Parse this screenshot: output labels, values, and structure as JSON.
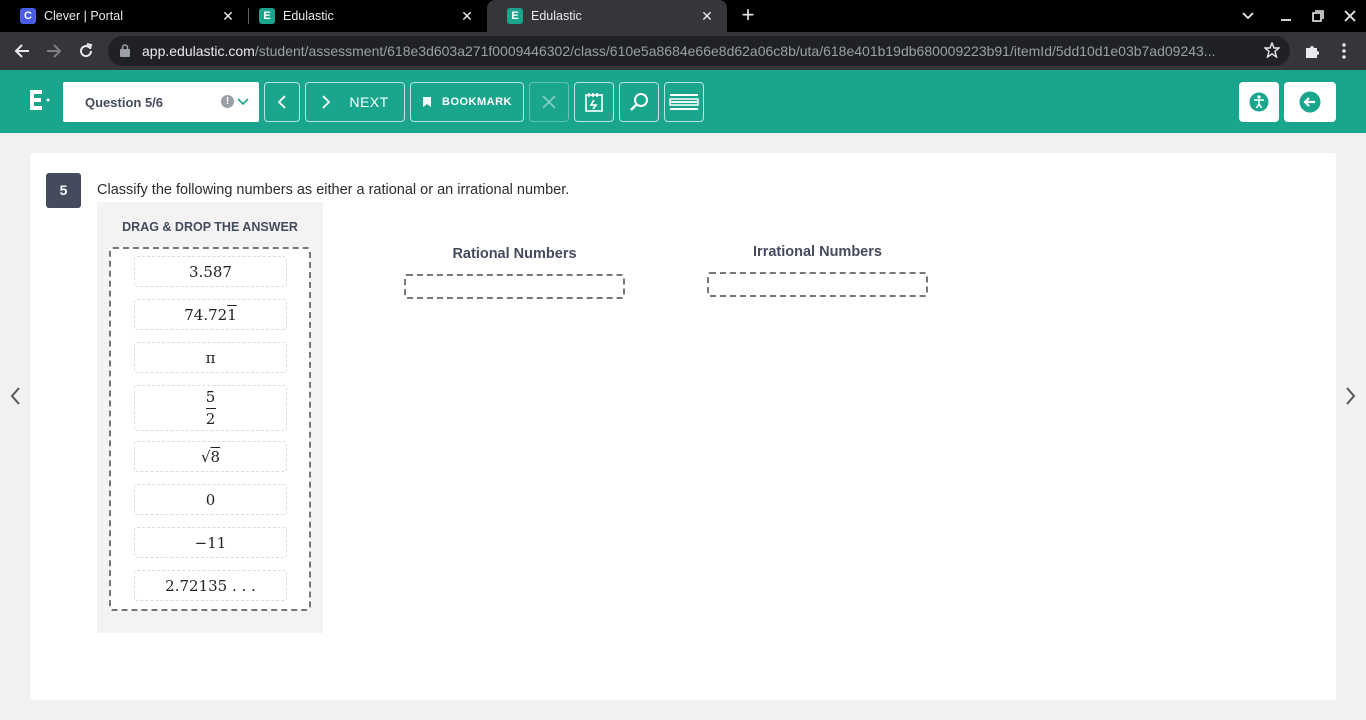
{
  "browser": {
    "tabs": [
      {
        "title": "Clever | Portal",
        "favicon": "C",
        "favicon_color": "#4a5de8"
      },
      {
        "title": "Edulastic",
        "favicon": "E",
        "favicon_color": "#1aa68d"
      },
      {
        "title": "Edulastic",
        "favicon": "E",
        "favicon_color": "#1aa68d"
      }
    ],
    "url_host": "app.edulastic.com",
    "url_path": "/student/assessment/618e3d603a271f0009446302/class/610e5a8684e66e8d62a06c8b/uta/618e401b19db680009223b91/itemId/5dd10d1e03b7ad09243..."
  },
  "header": {
    "question_label": "Question 5/6",
    "next_label": "NEXT",
    "bookmark_label": "BOOKMARK",
    "accent_color": "#1aa68d"
  },
  "question": {
    "number": "5",
    "text": "Classify the following numbers as either a rational or an irrational number.",
    "drag_title": "DRAG & DROP THE ANSWER",
    "choices": [
      "3.587",
      "74.72",
      "1",
      "π",
      "5",
      "2",
      "√",
      "8",
      "0",
      "−11",
      "2.72135 . . ."
    ],
    "columns": [
      "Rational Numbers",
      "Irrational Numbers"
    ]
  }
}
